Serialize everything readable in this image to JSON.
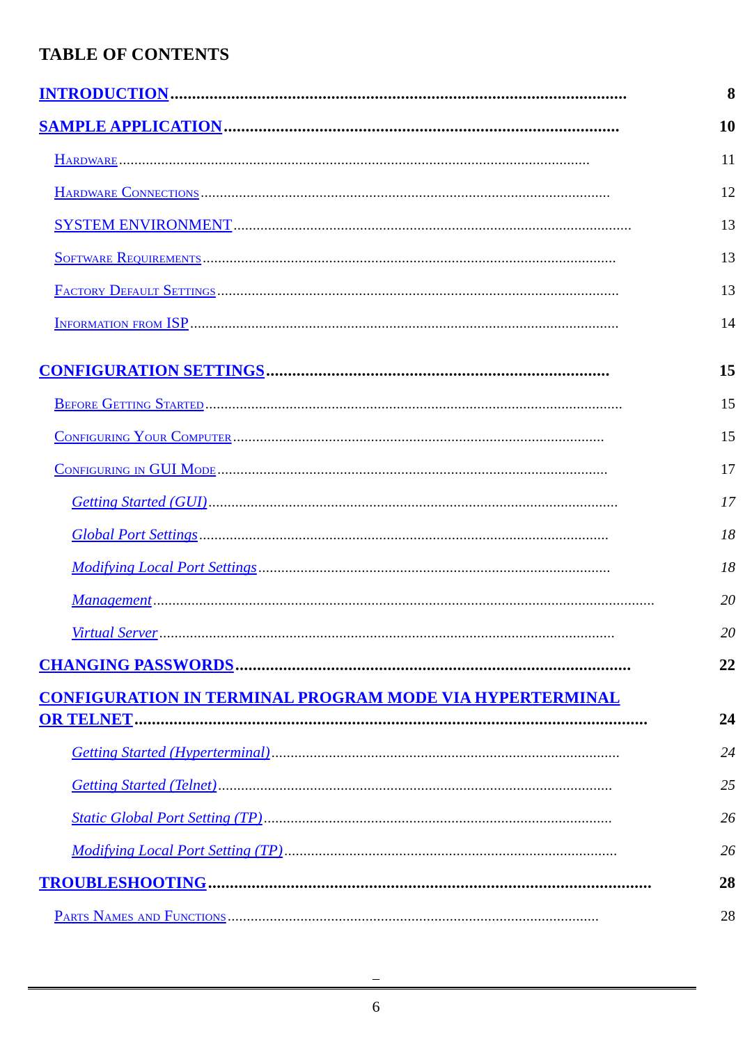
{
  "document": {
    "title": "TABLE OF CONTENTS",
    "footer_dash": "–",
    "footer_page_number": "6"
  },
  "colors": {
    "link": "#0000FF",
    "text": "#000000",
    "background": "#FFFFFF"
  },
  "toc": {
    "entries": [
      {
        "level": 1,
        "label": "INTRODUCTION",
        "page": "8",
        "leader": "........................................................................................................."
      },
      {
        "level": 1,
        "label": "SAMPLE APPLICATION",
        "page": "10",
        "leader": "..........................................................................................."
      },
      {
        "level": 2,
        "label": "Hardware",
        "page": "11",
        "leader": "..........................................................................................................................."
      },
      {
        "level": 2,
        "label": "Hardware Connections",
        "page": "12",
        "leader": "..........................................................................................................."
      },
      {
        "level": 2,
        "label": "SYSTEM ENVIRONMENT",
        "page": "13",
        "leader": "........................................................................................................",
        "allcaps": true
      },
      {
        "level": 2,
        "label": "Software Requirements",
        "page": "13",
        "leader": "............................................................................................................"
      },
      {
        "level": 2,
        "label": "Factory Default Settings",
        "page": "13",
        "leader": "........................................................................................................."
      },
      {
        "level": 2,
        "label": "Information from ISP",
        "page": "14",
        "leader": "................................................................................................................"
      },
      {
        "level": 1,
        "label": "CONFIGURATION SETTINGS",
        "page": "15",
        "leader": "...............................................................................",
        "spacer_before": true
      },
      {
        "level": 2,
        "label": "Before Getting Started",
        "page": "15",
        "leader": "............................................................................................................."
      },
      {
        "level": 2,
        "label": "Configuring Your Computer",
        "page": "15",
        "leader": "................................................................................................."
      },
      {
        "level": 2,
        "label": "Configuring in GUI Mode",
        "page": "17",
        "leader": "......................................................................................................"
      },
      {
        "level": 3,
        "label": "Getting Started (GUI)",
        "page": "17",
        "leader": "..........................................................................................................."
      },
      {
        "level": 3,
        "label": "Global Port Settings",
        "page": "18",
        "leader": "..........................................................................................................."
      },
      {
        "level": 3,
        "label": "Modifying Local Port Settings",
        "page": "18",
        "leader": "............................................................................................"
      },
      {
        "level": 3,
        "label": "Management",
        "page": "20",
        "leader": "..................................................................................................................................."
      },
      {
        "level": 3,
        "label": "Virtual Server",
        "page": "20",
        "leader": "......................................................................................................................."
      },
      {
        "level": 1,
        "label": "CHANGING PASSWORDS",
        "page": "22",
        "leader": "..........................................................................................."
      },
      {
        "level": 1,
        "label": "CONFIGURATION IN TERMINAL PROGRAM MODE VIA HYPERTERMINAL",
        "label_line2": "OR TELNET",
        "page": "24",
        "leader": "......................................................................................................................",
        "two_line": true
      },
      {
        "level": 3,
        "label": "Getting Started (Hyperterminal)",
        "page": "24",
        "leader": "..........................................................................................."
      },
      {
        "level": 3,
        "label": "Getting Started (Telnet)",
        "page": "25",
        "leader": "......................................................................................................."
      },
      {
        "level": 3,
        "label": "Static Global Port Setting (TP)",
        "page": "26",
        "leader": "..........................................................................................."
      },
      {
        "level": 3,
        "label": "Modifying Local Port Setting (TP)",
        "page": "26",
        "leader": "......................................................................................."
      },
      {
        "level": 1,
        "label": "TROUBLESHOOTING",
        "page": "28",
        "leader": "......................................................................................................"
      },
      {
        "level": 2,
        "label": "Parts Names and Functions",
        "page": "28",
        "leader": "................................................................................................."
      }
    ]
  }
}
